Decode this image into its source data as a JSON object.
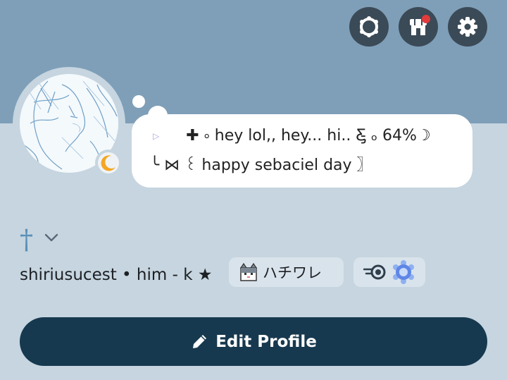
{
  "header": {
    "buttons": [
      {
        "icon": "wreath-badge-icon"
      },
      {
        "icon": "shop-icon",
        "notification": true
      },
      {
        "icon": "gear-icon"
      }
    ]
  },
  "profile": {
    "status_icon": "crescent-moon-icon",
    "status_color": "#f5a623",
    "bio_line1": "✚ ༚ hey lol,, hey... hi.. Ƹ̵̡ ₒ 64%☽",
    "bio_line2": "╰ ⋈ ꒰ happy sebaciel day 〗",
    "pronoun_symbol": "†",
    "name_line": "shiriusucest • him - k ★",
    "tag_cat_text": "ハチワレ",
    "edit_button_label": "Edit Profile"
  },
  "colors": {
    "banner": "#7f9fb8",
    "background": "#c6d5e0",
    "accent_button": "#17394f",
    "icon_button": "#3b4a57",
    "notification": "#e23b3b"
  }
}
